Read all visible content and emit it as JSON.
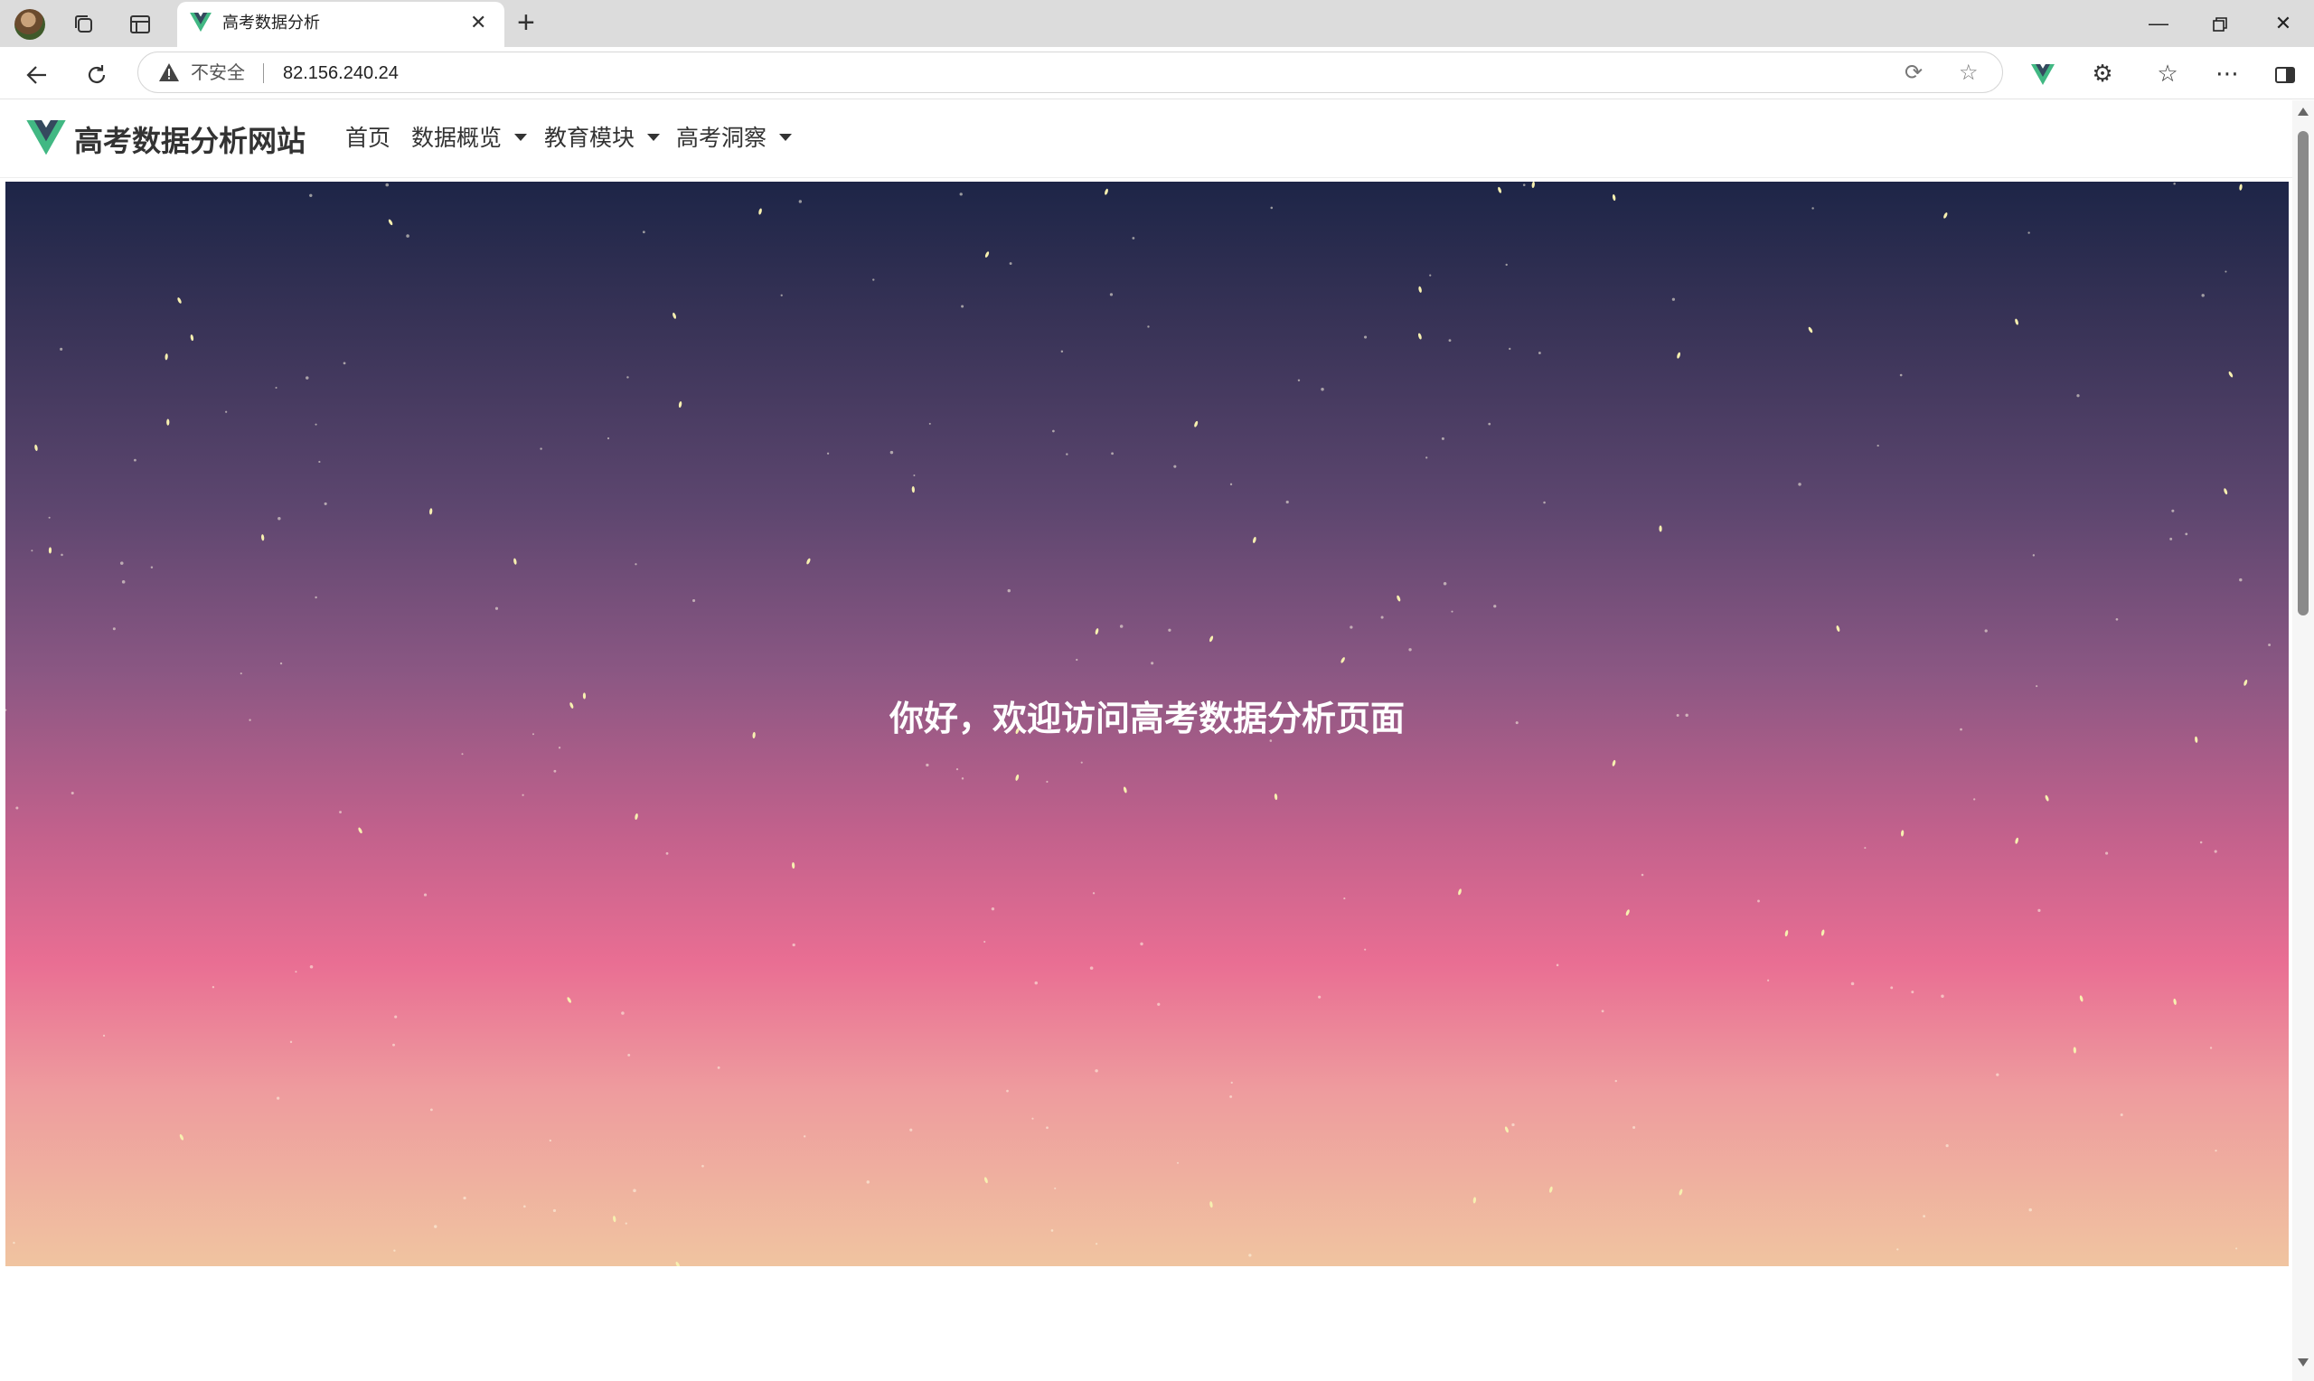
{
  "browser": {
    "tab_title": "高考数据分析",
    "new_tab_icon": "plus-icon",
    "security_label": "不安全",
    "url": "82.156.240.24",
    "window_controls": [
      "minimize-icon",
      "restore-icon",
      "close-icon"
    ]
  },
  "site": {
    "brand": "高考数据分析网站",
    "nav": [
      {
        "label": "首页"
      },
      {
        "label": "数据概览"
      },
      {
        "label": "教育模块"
      },
      {
        "label": "高考洞察"
      }
    ]
  },
  "hero": {
    "welcome": "你好，欢迎访问高考数据分析页面"
  },
  "colors": {
    "vue_green": "#41b883",
    "vue_dark": "#35495e",
    "hero_top": "#1d2547",
    "hero_pink": "#e96e93",
    "hero_bottom": "#f0c4a0"
  }
}
